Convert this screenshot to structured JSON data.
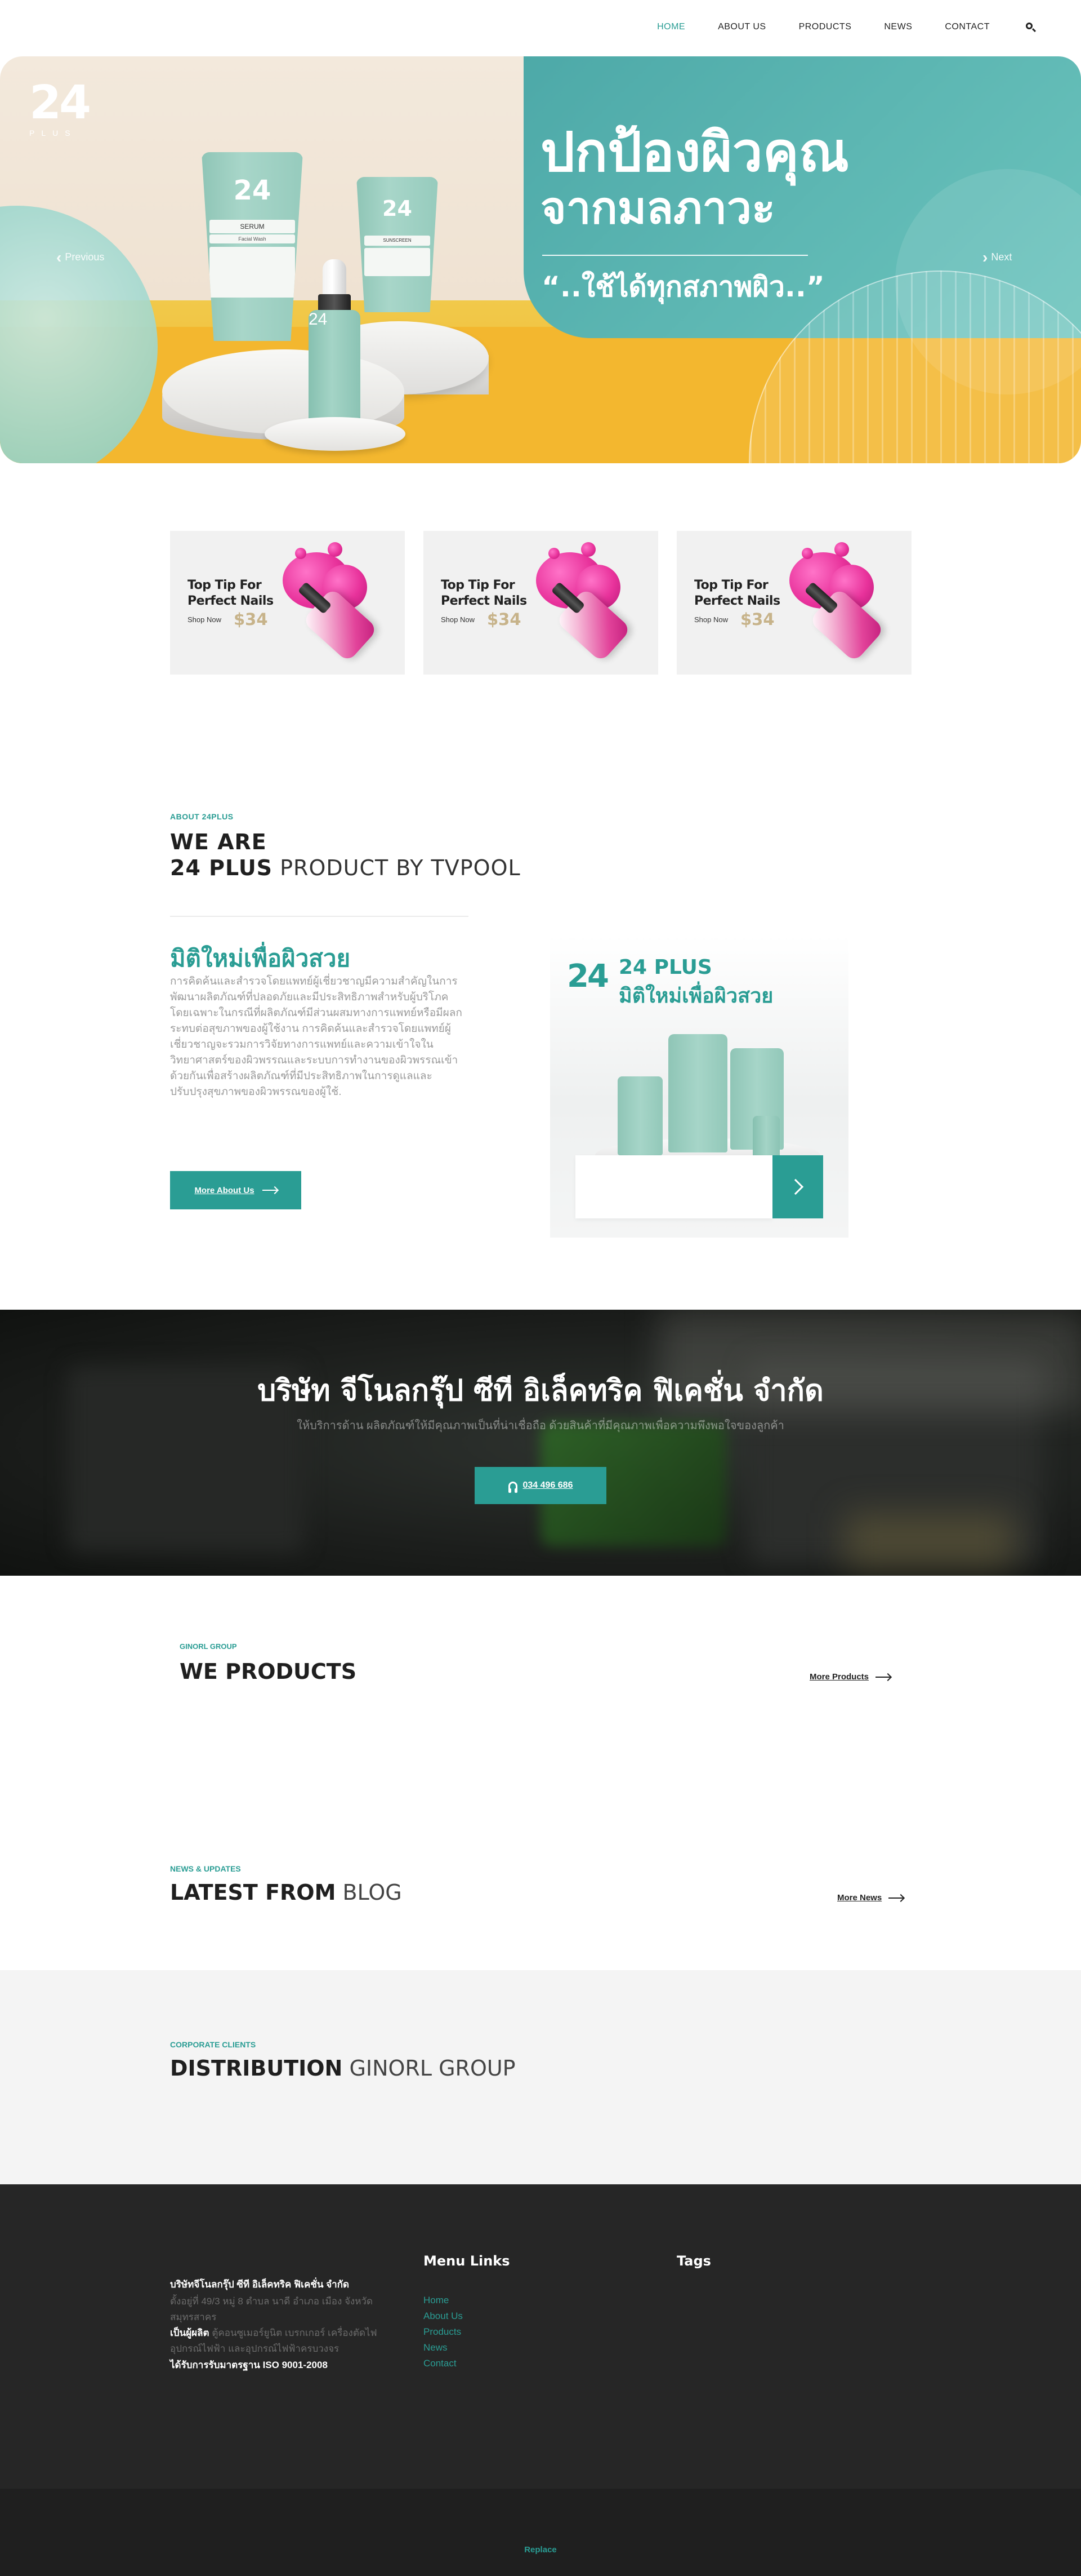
{
  "nav": {
    "items": [
      {
        "label": "HOME",
        "active": true
      },
      {
        "label": "ABOUT US",
        "active": false
      },
      {
        "label": "PRODUCTS",
        "active": false
      },
      {
        "label": "NEWS",
        "active": false
      },
      {
        "label": "CONTACT",
        "active": false
      }
    ],
    "search_icon": "search-icon"
  },
  "hero": {
    "logo_number": "24",
    "logo_text": "PLUS",
    "title_line1": "ปกป้องผิวคุณ",
    "title_line2": "จากมลภาวะ",
    "subtitle": "“..ใช้ได้ทุกสภาพผิว..”",
    "prev_label": "Previous",
    "next_label": "Next",
    "serum_label": "SERUM",
    "serum_sub": "Facial Wash",
    "sun_label": "SUNSCREEN"
  },
  "promos": [
    {
      "title_line1": "Top Tip For",
      "title_line2": "Perfect Nails",
      "shop_label": "Shop Now",
      "price": "$34"
    },
    {
      "title_line1": "Top Tip For",
      "title_line2": "Perfect Nails",
      "shop_label": "Shop Now",
      "price": "$34"
    },
    {
      "title_line1": "Top Tip For",
      "title_line2": "Perfect Nails",
      "shop_label": "Shop Now",
      "price": "$34"
    }
  ],
  "about": {
    "kicker": "ABOUT 24PLUS",
    "title_line1": "WE ARE",
    "title_bold": "24 PLUS",
    "title_light": "PRODUCT BY TVPOOL",
    "heading": "มิติใหม่เพื่อผิวสวย",
    "body": "การคิดค้นและสำรวจโดยแพทย์ผู้เชี่ยวชาญมีความสำคัญในการพัฒนาผลิตภัณฑ์ที่ปลอดภัยและมีประสิทธิภาพสำหรับผู้บริโภค โดยเฉพาะในกรณีที่ผลิตภัณฑ์มีส่วนผสมทางการแพทย์หรือมีผลกระทบต่อสุขภาพของผู้ใช้งาน การคิดค้นและสำรวจโดยแพทย์ผู้เชี่ยวชาญจะรวมการวิจัยทางการแพทย์และความเข้าใจในวิทยาศาสตร์ของผิวพรรณและระบบการทำงานของผิวพรรณเข้าด้วยกันเพื่อสร้างผลิตภัณฑ์ที่มีประสิทธิภาพในการดูแลและปรับปรุงสุขภาพของผิวพรรณของผู้ใช้.",
    "button_label": "More About Us",
    "image_logo": "24",
    "image_title1": "24 PLUS",
    "image_title2": "มิติใหม่เพื่อผิวสวย"
  },
  "banner": {
    "title": "บริษัท จีโนลกรุ๊ป ซีที อิเล็คทริค ฟิเคชั่น จำกัด",
    "subtitle": "ให้บริการด้าน ผลิตภัณฑ์ให้มีคุณภาพเป็นที่น่าเชื่อถือ ด้วยสินค้าที่มีคุณภาพเพื่อความพึงพอใจของลูกค้า",
    "button_label": "034 496 686"
  },
  "products": {
    "kicker": "GINORL GROUP",
    "title": "WE PRODUCTS",
    "more_label": "More Products"
  },
  "blog": {
    "kicker": "NEWS & UPDATES",
    "title_bold": "LATEST FROM",
    "title_light": "BLOG",
    "more_label": "More News"
  },
  "distribution": {
    "kicker": "CORPORATE CLIENTS",
    "title_bold": "DISTRIBUTION",
    "title_light": "GINORL GROUP"
  },
  "footer": {
    "company": "บริษัทจีโนลกรุ๊ป ซีที อิเล็คทริค ฟิเคชั่น จำกัด",
    "address": "ตั้งอยู่ที่ 49/3 หมู่ 8 ตำบล นาดี อำเภอ เมือง จังหวัด สมุทรสาคร",
    "maker_label": "เป็นผู้ผลิต",
    "maker_text": "ตู้คอนซูเมอร์ยูนิต เบรกเกอร์ เครื่องตัดไฟ อุปกรณ์ไฟฟ้า และอุปกรณ์ไฟฟ้าครบวงจร",
    "iso": "ได้รับการรับมาตรฐาน ISO 9001-2008",
    "menu_heading": "Menu Links",
    "menu_links": [
      "Home",
      "About Us",
      "Products",
      "News",
      "Contact"
    ],
    "tags_heading": "Tags",
    "replace_label": "Replace"
  },
  "colors": {
    "accent": "#2a9d94",
    "footer_bg": "#262626",
    "price_gold": "#c7b38a"
  }
}
